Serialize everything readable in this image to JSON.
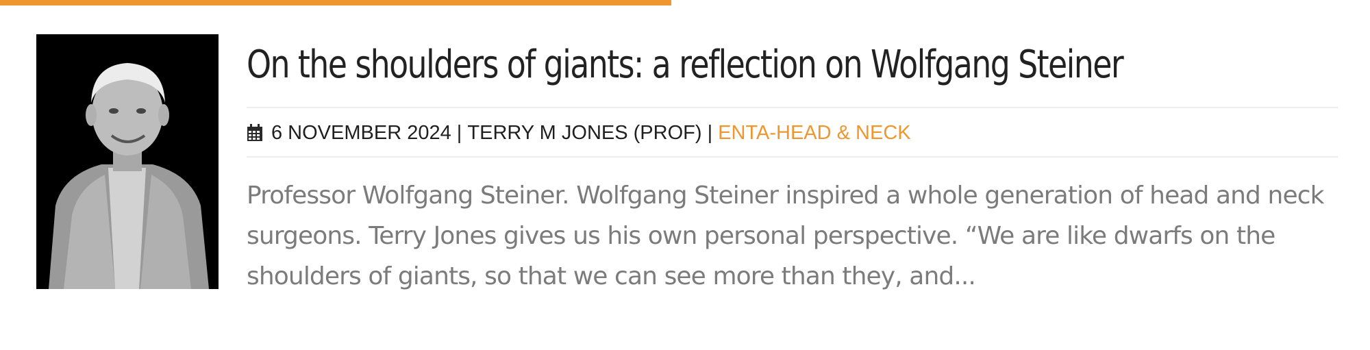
{
  "accent_color": "#f0962e",
  "article": {
    "image_alt": "Professor Wolfgang Steiner",
    "title": "On the shoulders of giants: a reflection on Wolfgang Steiner",
    "meta": {
      "icon": "calendar-icon",
      "date": "6 NOVEMBER 2024",
      "separator_1": " | ",
      "author": "TERRY M JONES (PROF)",
      "separator_2": " | ",
      "category": "ENTA-HEAD & NECK"
    },
    "excerpt": "Professor Wolfgang Steiner. Wolfgang Steiner inspired a whole generation of head and neck surgeons. Terry Jones gives us his own personal perspective. “We are like dwarfs on the shoulders of giants, so that we can see more than they, and..."
  }
}
